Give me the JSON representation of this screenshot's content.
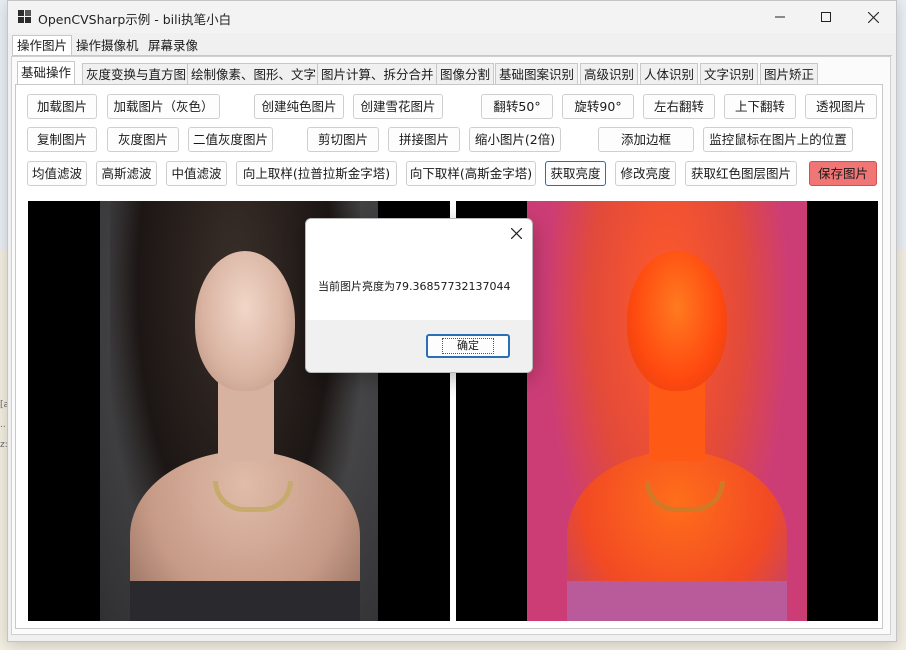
{
  "window": {
    "title": "OpenCVSharp示例 - bili执笔小白"
  },
  "menu": {
    "items": [
      {
        "label": "操作图片",
        "active": true
      },
      {
        "label": "操作摄像机",
        "active": false
      },
      {
        "label": "屏幕录像",
        "active": false
      }
    ]
  },
  "tabs": [
    {
      "label": "基础操作",
      "active": true
    },
    {
      "label": "灰度变换与直方图"
    },
    {
      "label": "绘制像素、图形、文字"
    },
    {
      "label": "图片计算、拆分合并"
    },
    {
      "label": "图像分割"
    },
    {
      "label": "基础图案识别"
    },
    {
      "label": "高级识别"
    },
    {
      "label": "人体识别"
    },
    {
      "label": "文字识别"
    },
    {
      "label": "图片矫正"
    }
  ],
  "buttons": {
    "row1": [
      "加载图片",
      "加载图片（灰色）",
      "创建纯色图片",
      "创建雪花图片",
      "翻转50°",
      "旋转90°",
      "左右翻转",
      "上下翻转",
      "透视图片"
    ],
    "row2": [
      "复制图片",
      "灰度图片",
      "二值灰度图片",
      "剪切图片",
      "拼接图片",
      "缩小图片(2倍)",
      "添加边框",
      "监控鼠标在图片上的位置"
    ],
    "row3": [
      "均值滤波",
      "高斯滤波",
      "中值滤波",
      "向上取样(拉普拉斯金字塔)",
      "向下取样(高斯金字塔)",
      "获取亮度",
      "修改亮度",
      "获取红色图层图片",
      "保存图片"
    ]
  },
  "dialog": {
    "message": "当前图片亮度为79.36857732137044",
    "ok_label": "确定"
  },
  "desktop": {
    "marks": [
      "[a",
      "..",
      "z:"
    ]
  },
  "colors": {
    "focus": "#2a6fb5",
    "save_button": "#f07575"
  }
}
